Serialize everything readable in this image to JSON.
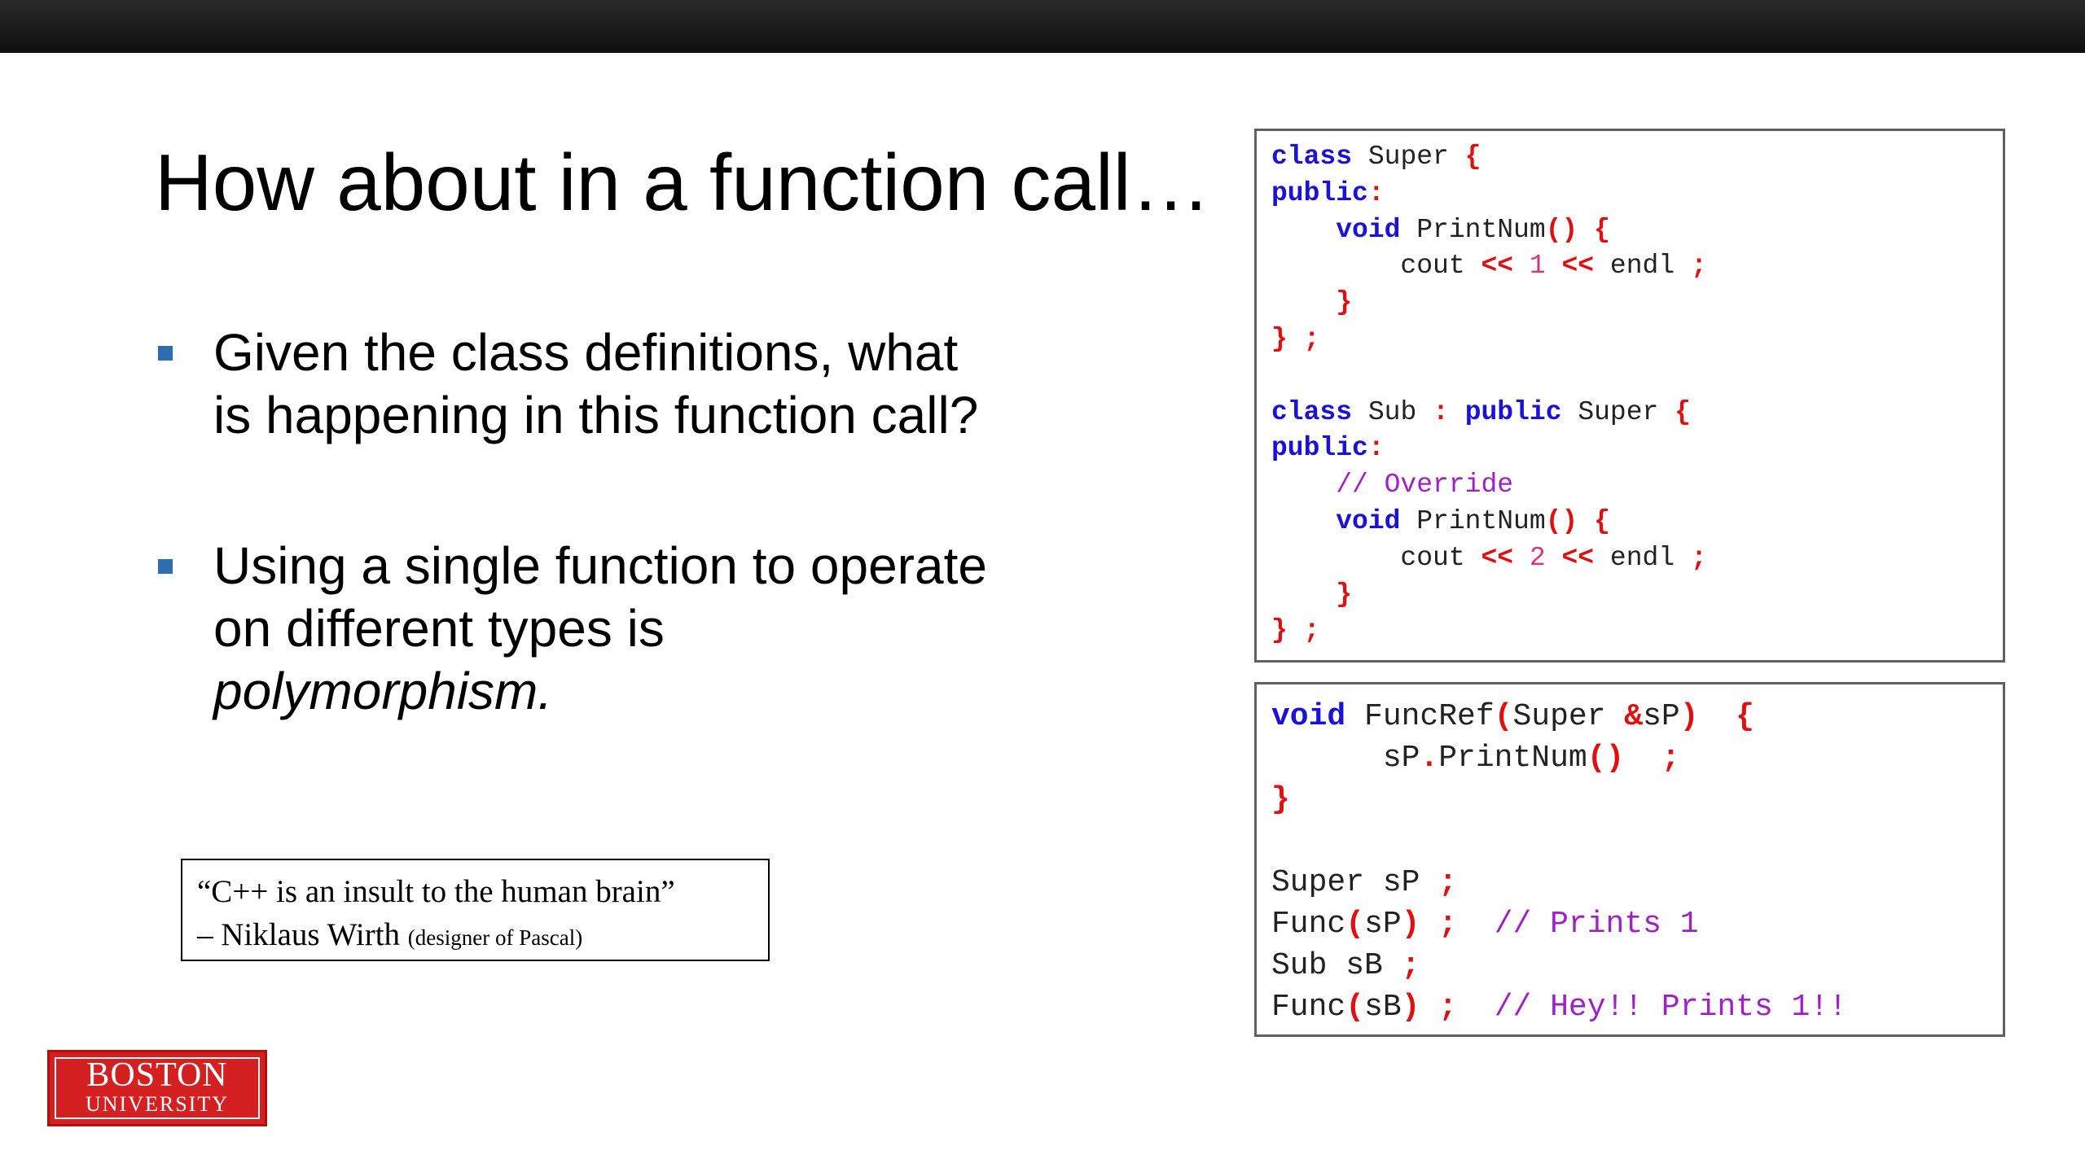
{
  "slide": {
    "title": "How about in a function call…",
    "bullets": [
      {
        "lines": [
          "Given the class definitions, what",
          "is happening in this function call?"
        ]
      },
      {
        "lines": [
          "Using a single function to operate",
          "on different types is"
        ],
        "emphasis": "polymorphism."
      }
    ]
  },
  "quote": {
    "text": "“C++ is an insult to the human brain”",
    "attribution": "– Niklaus Wirth",
    "note": "(designer of Pascal)"
  },
  "logo": {
    "line1": "BOSTON",
    "line2": "UNIVERSITY",
    "color": "#d42020"
  },
  "code_class_defs": [
    [
      {
        "t": "class",
        "c": "kw"
      },
      {
        "t": " Super "
      },
      {
        "t": "{",
        "c": "op"
      }
    ],
    [
      {
        "t": "public",
        "c": "kw"
      },
      {
        "t": ":",
        "c": "op"
      }
    ],
    [
      {
        "t": "    "
      },
      {
        "t": "void",
        "c": "kw"
      },
      {
        "t": " PrintNum"
      },
      {
        "t": "()",
        "c": "op"
      },
      {
        "t": " "
      },
      {
        "t": "{",
        "c": "op"
      }
    ],
    [
      {
        "t": "        cout "
      },
      {
        "t": "<<",
        "c": "op"
      },
      {
        "t": " "
      },
      {
        "t": "1",
        "c": "num"
      },
      {
        "t": " "
      },
      {
        "t": "<<",
        "c": "op"
      },
      {
        "t": " endl "
      },
      {
        "t": ";",
        "c": "op"
      }
    ],
    [
      {
        "t": "    "
      },
      {
        "t": "}",
        "c": "op"
      }
    ],
    [
      {
        "t": "}",
        "c": "op"
      },
      {
        "t": " "
      },
      {
        "t": ";",
        "c": "op"
      }
    ],
    [
      {
        "t": ""
      }
    ],
    [
      {
        "t": "class",
        "c": "kw"
      },
      {
        "t": " Sub "
      },
      {
        "t": ":",
        "c": "op"
      },
      {
        "t": " "
      },
      {
        "t": "public",
        "c": "kw"
      },
      {
        "t": " Super "
      },
      {
        "t": "{",
        "c": "op"
      }
    ],
    [
      {
        "t": "public",
        "c": "kw"
      },
      {
        "t": ":",
        "c": "op"
      }
    ],
    [
      {
        "t": "    "
      },
      {
        "t": "// Override",
        "c": "cm"
      }
    ],
    [
      {
        "t": "    "
      },
      {
        "t": "void",
        "c": "kw"
      },
      {
        "t": " PrintNum"
      },
      {
        "t": "()",
        "c": "op"
      },
      {
        "t": " "
      },
      {
        "t": "{",
        "c": "op"
      }
    ],
    [
      {
        "t": "        cout "
      },
      {
        "t": "<<",
        "c": "op"
      },
      {
        "t": " "
      },
      {
        "t": "2",
        "c": "num"
      },
      {
        "t": " "
      },
      {
        "t": "<<",
        "c": "op"
      },
      {
        "t": " endl "
      },
      {
        "t": ";",
        "c": "op"
      }
    ],
    [
      {
        "t": "    "
      },
      {
        "t": "}",
        "c": "op"
      }
    ],
    [
      {
        "t": "}",
        "c": "op"
      },
      {
        "t": " "
      },
      {
        "t": ";",
        "c": "op"
      }
    ]
  ],
  "code_function_call": [
    [
      {
        "t": "void",
        "c": "kw"
      },
      {
        "t": " FuncRef"
      },
      {
        "t": "(",
        "c": "op"
      },
      {
        "t": "Super "
      },
      {
        "t": "&",
        "c": "op"
      },
      {
        "t": "sP"
      },
      {
        "t": ")",
        "c": "op"
      },
      {
        "t": "  "
      },
      {
        "t": "{",
        "c": "op"
      }
    ],
    [
      {
        "t": "      sP"
      },
      {
        "t": ".",
        "c": "op"
      },
      {
        "t": "PrintNum"
      },
      {
        "t": "()",
        "c": "op"
      },
      {
        "t": "  "
      },
      {
        "t": ";",
        "c": "op"
      }
    ],
    [
      {
        "t": "}",
        "c": "op"
      }
    ],
    [
      {
        "t": ""
      }
    ],
    [
      {
        "t": "Super sP "
      },
      {
        "t": ";",
        "c": "op"
      }
    ],
    [
      {
        "t": "Func"
      },
      {
        "t": "(",
        "c": "op"
      },
      {
        "t": "sP"
      },
      {
        "t": ")",
        "c": "op"
      },
      {
        "t": " "
      },
      {
        "t": ";",
        "c": "op"
      },
      {
        "t": "  "
      },
      {
        "t": "// Prints 1",
        "c": "cm"
      }
    ],
    [
      {
        "t": "Sub sB "
      },
      {
        "t": ";",
        "c": "op"
      }
    ],
    [
      {
        "t": "Func"
      },
      {
        "t": "(",
        "c": "op"
      },
      {
        "t": "sB"
      },
      {
        "t": ")",
        "c": "op"
      },
      {
        "t": " "
      },
      {
        "t": ";",
        "c": "op"
      },
      {
        "t": "  "
      },
      {
        "t": "// Hey!! Prints 1!!",
        "c": "cm"
      }
    ]
  ]
}
